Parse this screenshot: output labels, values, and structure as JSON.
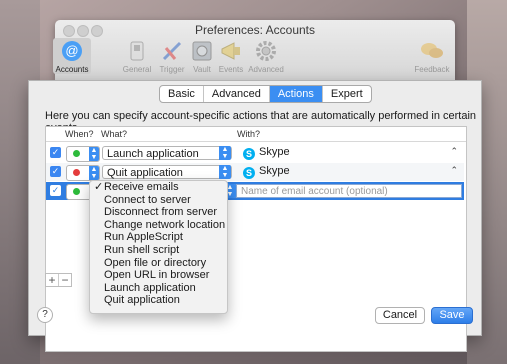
{
  "window": {
    "title": "Preferences: Accounts",
    "toolbar": [
      {
        "label": "Accounts",
        "icon": "at-sign-icon",
        "active": true
      },
      {
        "label": "General",
        "icon": "switch-icon"
      },
      {
        "label": "Trigger",
        "icon": "trigger-icon"
      },
      {
        "label": "Vault",
        "icon": "vault-icon"
      },
      {
        "label": "Events",
        "icon": "megaphone-icon"
      },
      {
        "label": "Advanced",
        "icon": "gear-icon"
      },
      {
        "label": "Feedback",
        "icon": "speech-bubble-icon"
      }
    ]
  },
  "tabs": [
    "Basic",
    "Advanced",
    "Actions",
    "Expert"
  ],
  "active_tab": "Actions",
  "intro": "Here you can specify account-specific actions that are automatically performed in certain events.",
  "table": {
    "headers": [
      "When?",
      "What?",
      "With?"
    ],
    "rows": [
      {
        "checked": true,
        "status": "green",
        "what": "Launch application",
        "with": "Skype"
      },
      {
        "checked": true,
        "status": "red",
        "what": "Quit application",
        "with": "Skype"
      },
      {
        "checked": true,
        "status": "green",
        "what": "",
        "with_placeholder": "Name of email account (optional)"
      }
    ]
  },
  "menu": {
    "selected": "Receive emails",
    "items": [
      "Receive emails",
      "Connect to server",
      "Disconnect from server",
      "Change network location",
      "Run AppleScript",
      "Run shell script",
      "Open file or directory",
      "Open URL in browser",
      "Launch application",
      "Quit application"
    ]
  },
  "buttons": {
    "cancel": "Cancel",
    "save": "Save",
    "help": "?",
    "add": "+",
    "remove": "−"
  },
  "colors": {
    "accent": "#3b8ef2",
    "selected_row": "#2f7de1",
    "status_green": "#2dbb3b",
    "status_red": "#e43c3c",
    "skype": "#00aff0"
  }
}
